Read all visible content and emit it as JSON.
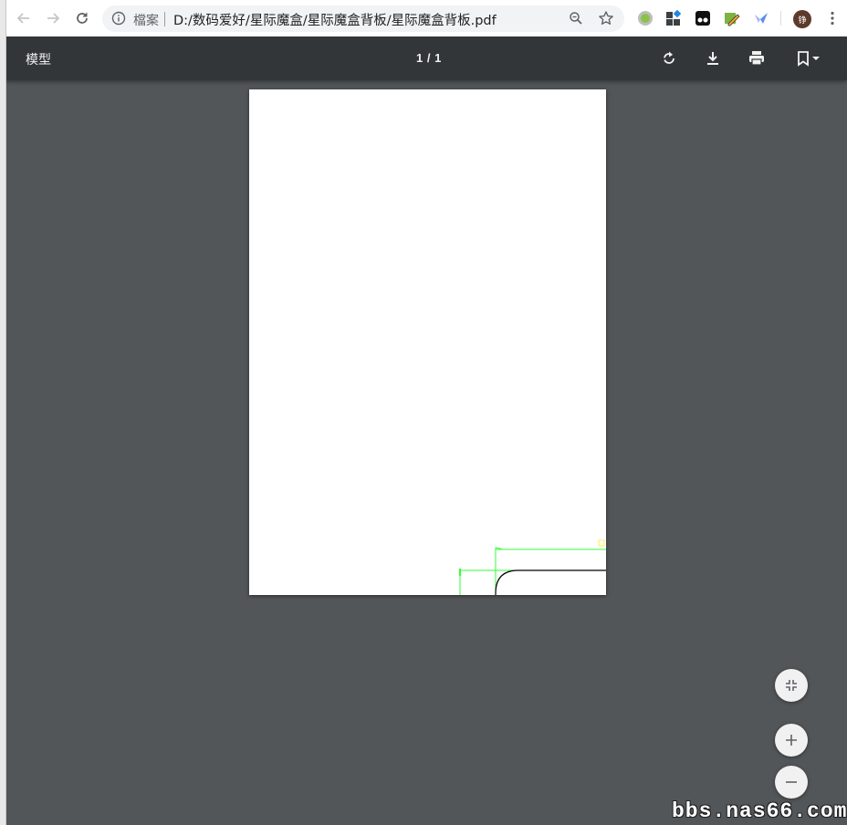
{
  "browser": {
    "info_label": "檔案",
    "url": "D:/数码爱好/星际魔盒/星际魔盒背板/星际魔盒背板.pdf",
    "avatar_initial": "铮",
    "extensions": [
      "green-dot-extension-icon",
      "app-grid-extension-icon",
      "tampermonkey-extension-icon",
      "pencil-extension-icon",
      "bird-extension-icon"
    ]
  },
  "pdf_viewer": {
    "title": "模型",
    "page_indicator": "1 / 1",
    "toolbar_buttons": [
      "rotate",
      "download",
      "print",
      "bookmark"
    ],
    "zoom_buttons": [
      "fit-to-page",
      "zoom-in",
      "zoom-out"
    ]
  },
  "colors": {
    "toolbar_bg": "#323639",
    "viewer_bg": "#525659",
    "drawing_green": "#33ff33",
    "drawing_yellow": "#ffee55"
  },
  "watermark": "bbs.nas66.com"
}
